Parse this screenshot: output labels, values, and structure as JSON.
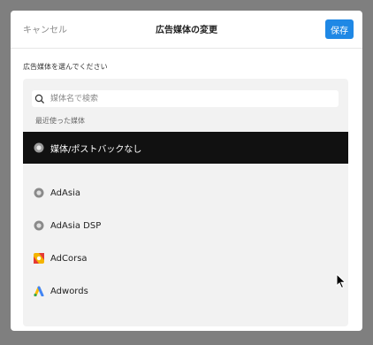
{
  "header": {
    "cancel_label": "キャンセル",
    "title": "広告媒体の変更",
    "save_label": "保存"
  },
  "prompt": "広告媒体を選んでください",
  "search": {
    "placeholder": "媒体名で検索"
  },
  "section_label": "最近使った媒体",
  "options": [
    {
      "label": "媒体/ポストバックなし",
      "icon": "circle-icon",
      "selected": true
    },
    {
      "label": "AdAsia",
      "icon": "circle-icon",
      "selected": false
    },
    {
      "label": "AdAsia DSP",
      "icon": "circle-icon",
      "selected": false
    },
    {
      "label": "AdCorsa",
      "icon": "adcorsa-logo-icon",
      "selected": false
    },
    {
      "label": "Adwords",
      "icon": "google-ads-logo-icon",
      "selected": false
    }
  ],
  "colors": {
    "overlay": "#7f7f7f",
    "accent": "#1f88e5",
    "selected_row": "#111111"
  }
}
